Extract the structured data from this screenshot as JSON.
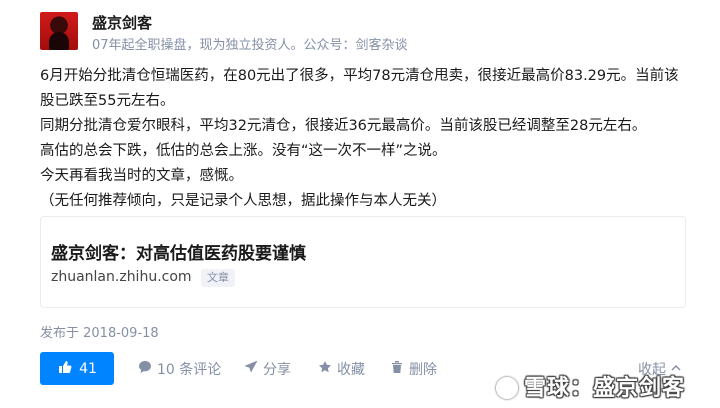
{
  "header": {
    "author": "盛京剑客",
    "bio": "07年起全职操盘，现为独立投资人。公众号：剑客杂谈"
  },
  "content": {
    "paragraphs": [
      "6月开始分批清仓恒瑞医药，在80元出了很多，平均78元清仓甩卖，很接近最高价83.29元。当前该股已跌至55元左右。",
      "同期分批清仓爱尔眼科，平均32元清仓，很接近36元最高价。当前该股已经调整至28元左右。",
      "高估的总会下跌，低估的总会上涨。没有“这一次不一样”之说。",
      "今天再看我当时的文章，感慨。",
      "（无任何推荐倾向，只是记录个人思想，据此操作与本人无关）"
    ]
  },
  "link_card": {
    "title": "盛京剑客：对高估值医药股要谨慎",
    "url": "zhuanlan.zhihu.com",
    "tag": "文章"
  },
  "pubdate": "发布于 2018-09-18",
  "actions": {
    "vote_count": "41",
    "comment": "10 条评论",
    "share": "分享",
    "collect": "收藏",
    "delete": "删除",
    "collapse": "收起"
  },
  "watermark": "雪球：盛京剑客",
  "colors": {
    "accent": "#0084ff",
    "muted": "#8590a6"
  }
}
